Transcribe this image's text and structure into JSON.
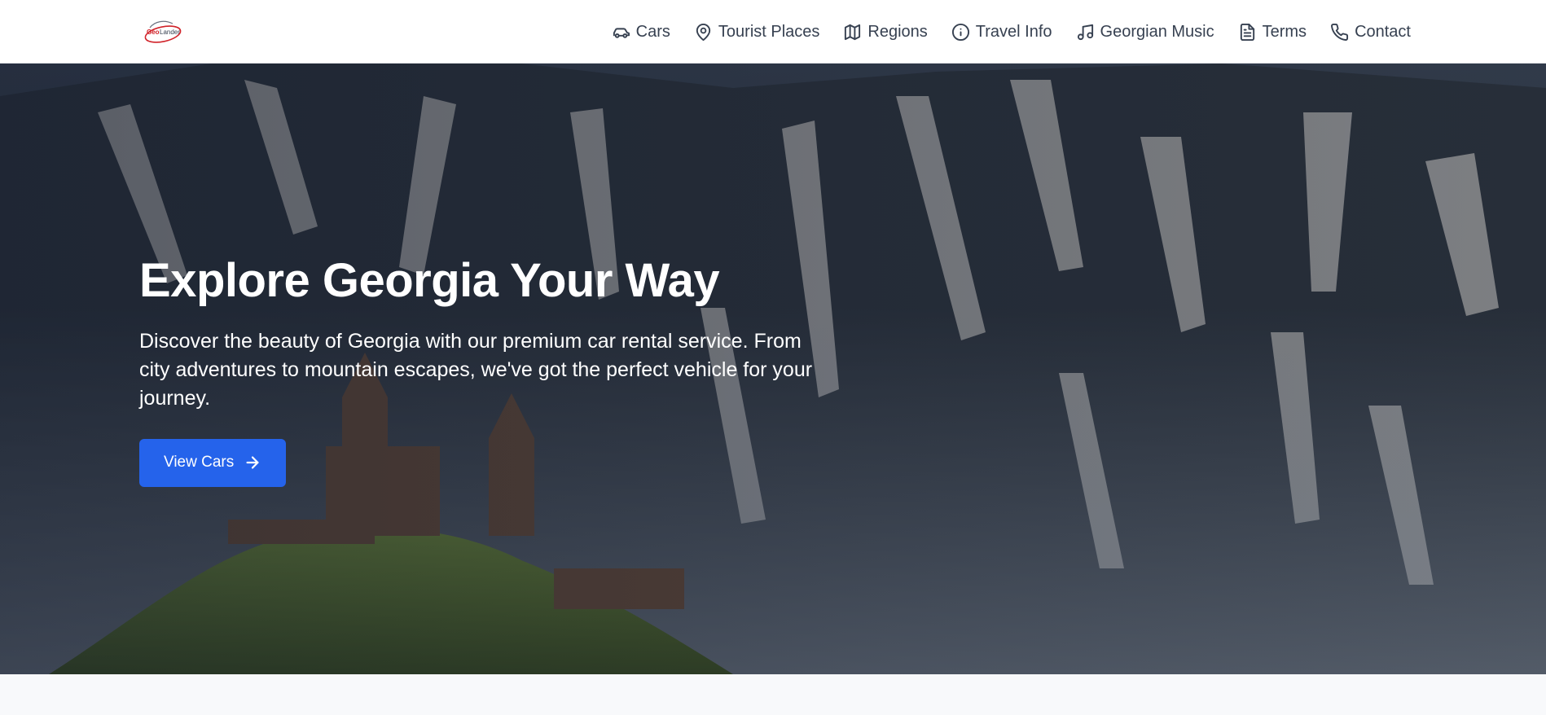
{
  "header": {
    "logo_text": "GeoLander",
    "nav": [
      {
        "label": "Cars",
        "icon": "car-icon"
      },
      {
        "label": "Tourist Places",
        "icon": "map-pin-icon"
      },
      {
        "label": "Regions",
        "icon": "map-icon"
      },
      {
        "label": "Travel Info",
        "icon": "info-icon"
      },
      {
        "label": "Georgian Music",
        "icon": "music-icon"
      },
      {
        "label": "Terms",
        "icon": "document-icon"
      },
      {
        "label": "Contact",
        "icon": "phone-icon"
      }
    ]
  },
  "hero": {
    "title": "Explore Georgia Your Way",
    "description": "Discover the beauty of Georgia with our premium car rental service. From city adventures to mountain escapes, we've got the perfect vehicle for your journey.",
    "cta_label": "View Cars",
    "cta_icon": "arrow-right-icon"
  },
  "colors": {
    "primary": "#2563eb",
    "nav_text": "#374151",
    "header_bg": "#ffffff",
    "page_bg": "#f8f9fb"
  }
}
